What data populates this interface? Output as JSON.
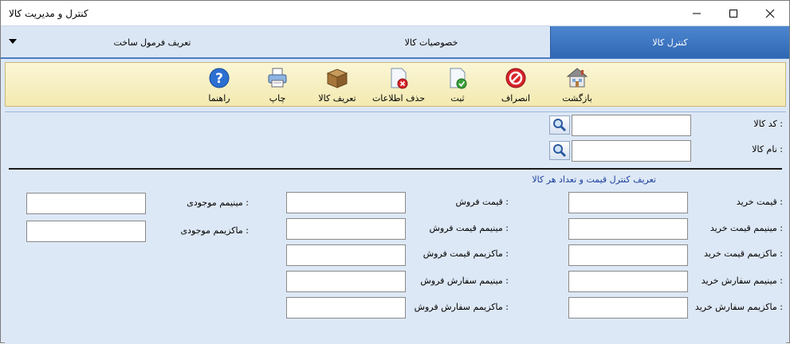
{
  "window": {
    "title": "کنترل و مدیریت کالا",
    "minimize_glyph": "—",
    "maximize_glyph": "☐",
    "close_glyph": "✕"
  },
  "tabs": [
    {
      "label": "کنترل کالا",
      "active": true
    },
    {
      "label": "خصوصیات کالا",
      "active": false
    },
    {
      "label": "تعریف فرمول ساخت",
      "active": false
    }
  ],
  "toolbar": {
    "back": {
      "label": "بازگشت",
      "icon": "house-icon"
    },
    "cancel": {
      "label": "انصراف",
      "icon": "cancel-icon"
    },
    "save": {
      "label": "ثبت",
      "icon": "document-check-icon"
    },
    "delete": {
      "label": "حذف اطلاعات",
      "icon": "document-delete-icon"
    },
    "define_item": {
      "label": "تعریف کالا",
      "icon": "box-icon"
    },
    "print": {
      "label": "چاپ",
      "icon": "printer-icon"
    },
    "help": {
      "label": "راهنما",
      "icon": "help-icon"
    }
  },
  "search": {
    "code_label": "کد کالا :",
    "code_value": "",
    "name_label": "نام کالا :",
    "name_value": ""
  },
  "section": {
    "title": "تعریف کنترل قیمت و تعداد هر کالا"
  },
  "fields": {
    "purchase_price": {
      "label": "قیمت خرید :",
      "value": ""
    },
    "min_purchase_price": {
      "label": "مینیمم قیمت خرید :",
      "value": ""
    },
    "max_purchase_price": {
      "label": "ماکزیمم قیمت خرید :",
      "value": ""
    },
    "min_purchase_order": {
      "label": "مینیمم سفارش خرید :",
      "value": ""
    },
    "max_purchase_order": {
      "label": "ماکزیمم سفارش خرید :",
      "value": ""
    },
    "sale_price": {
      "label": "قیمت فروش :",
      "value": ""
    },
    "min_sale_price": {
      "label": "مینیمم قیمت فروش :",
      "value": ""
    },
    "max_sale_price": {
      "label": "ماکزیمم قیمت فروش :",
      "value": ""
    },
    "min_sale_order": {
      "label": "مینیمم سفارش فروش :",
      "value": ""
    },
    "max_sale_order": {
      "label": "ماکزیمم سفارش فروش :",
      "value": ""
    },
    "min_stock": {
      "label": "مینیمم موجودی :",
      "value": ""
    },
    "max_stock": {
      "label": "ماکزیمم موجودی :",
      "value": ""
    }
  },
  "colors": {
    "accent": "#2f67b4",
    "toolbar_bg": "#f3e9b0",
    "panel_bg": "#dde8f6",
    "section_title": "#1a3f9e"
  }
}
